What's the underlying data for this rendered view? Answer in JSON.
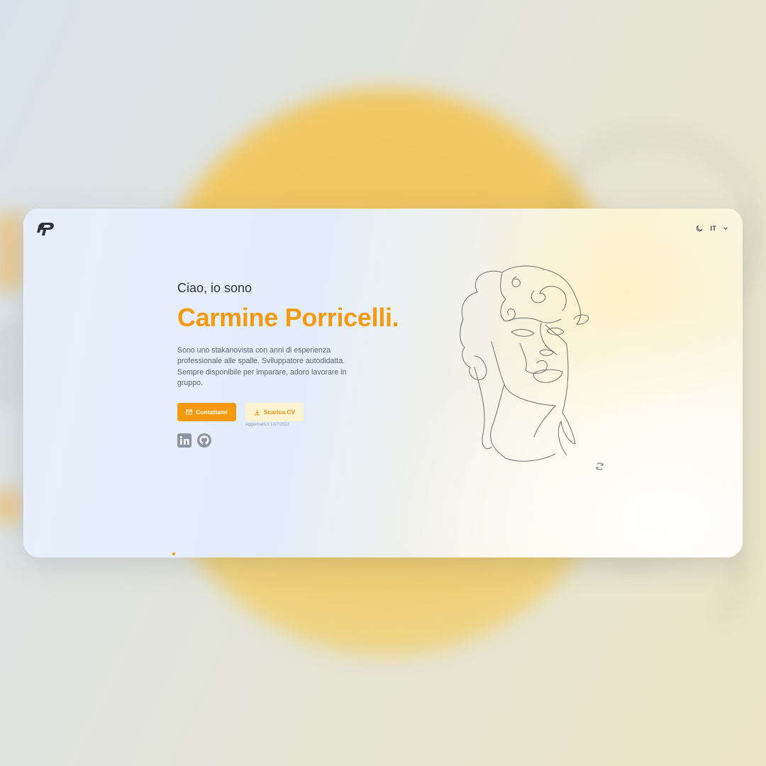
{
  "header": {
    "language": "IT"
  },
  "hero": {
    "greeting": "Ciao, io sono",
    "name": "Carmine Porricelli.",
    "description": "Sono uno stakanovista con anni di esperienza professionale alle spalle. Sviluppatore autodidatta. Sempre disponibile per imparare, adoro lavorare in gruppo."
  },
  "actions": {
    "contact_label": "Contattami",
    "cv_label": "Scarica CV",
    "cv_updated": "Aggiornato il 10/7/2022"
  },
  "icons": [
    "logo-icon",
    "moon-icon",
    "chevron-down-icon",
    "mail-icon",
    "download-icon",
    "linkedin-icon",
    "github-icon",
    "refresh-icon"
  ],
  "colors": {
    "accent": "#f59a10",
    "accent_soft": "#fbf3d2",
    "text_dark": "#2f343c",
    "text_muted": "#5b6270"
  }
}
